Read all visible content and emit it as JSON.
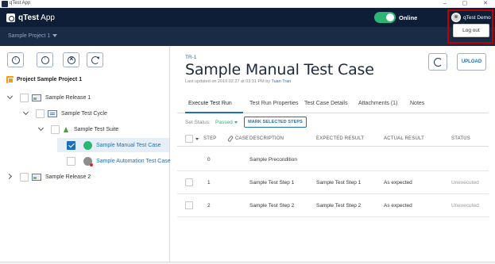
{
  "window": {
    "title": "qTest App",
    "minimize": "–",
    "maximize": "▢",
    "close": "✕"
  },
  "header": {
    "logo_bold": "qTest",
    "logo_regular": " App",
    "online_label": "Online",
    "user_name": "qTest Demo",
    "logout_label": "Log out",
    "highlight_color": "#c00000"
  },
  "projectbar": {
    "project_name": "Sample Project 1"
  },
  "sidebar": {
    "project_label": "Project Sample Project 1",
    "tree": [
      {
        "label": "Sample Release 1",
        "type": "release"
      },
      {
        "label": "Sample Test Cycle",
        "type": "cycle"
      },
      {
        "label": "Sample Test Suite",
        "type": "suite"
      },
      {
        "label": "Sample Manual Test Case",
        "type": "test-case",
        "selected": true
      },
      {
        "label": "Sample Automation Test Case",
        "type": "test-case"
      },
      {
        "label": "Sample Release 2",
        "type": "release"
      }
    ]
  },
  "main": {
    "id": "TR-1",
    "title": "Sample Manual Test Case",
    "updated_prefix": "Last updated on 2019.02.27 at 03:31 PM by ",
    "updated_by": "Tuan Tran",
    "upload_label": "UPLOAD",
    "tabs": [
      {
        "label": "Execute Test Run",
        "active": true
      },
      {
        "label": "Test Run Properties"
      },
      {
        "label": "Test Case Details"
      },
      {
        "label": "Attachments (1)"
      },
      {
        "label": "Notes"
      }
    ],
    "set_status_label": "Set Status:",
    "status_value": "Passed",
    "status_color": "#2bb673",
    "mark_button": "MARK SELECTED STEPS",
    "columns": [
      "STEP",
      "CASE",
      "DESCRIPTION",
      "EXPECTED RESULT",
      "ACTUAL RESULT",
      "STATUS"
    ],
    "rows": [
      {
        "step": "0",
        "description": "Sample Precondition",
        "expected": "",
        "actual": "",
        "status": ""
      },
      {
        "step": "1",
        "description": "Sample Test Step 1",
        "expected": "Sample Test Step 1",
        "actual": "As expected",
        "status": "Unexecuted"
      },
      {
        "step": "2",
        "description": "Sample Test Step 2",
        "expected": "Sample Test Step 2",
        "actual": "As expected",
        "status": "Unexecuted"
      }
    ]
  },
  "colors": {
    "header_bg": "#0e1e36",
    "project_bar_bg": "#1a2b45",
    "accent": "#1f6fb8",
    "toggle_on": "#2bb673"
  }
}
